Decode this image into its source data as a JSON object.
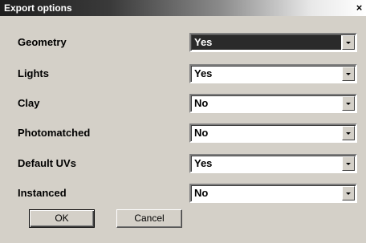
{
  "dialog": {
    "title": "Export options",
    "close_glyph": "×"
  },
  "options": [
    {
      "label": "Geometry",
      "value": "Yes",
      "highlighted": true
    },
    {
      "label": "Lights",
      "value": "Yes",
      "highlighted": false
    },
    {
      "label": "Clay",
      "value": "No",
      "highlighted": false
    },
    {
      "label": "Photomatched",
      "value": "No",
      "highlighted": false
    },
    {
      "label": "Default UVs",
      "value": "Yes",
      "highlighted": false
    },
    {
      "label": "Instanced",
      "value": "No",
      "highlighted": false
    }
  ],
  "buttons": {
    "ok_label": "OK",
    "cancel_label": "Cancel"
  },
  "icons": {
    "close": "close-icon",
    "dropdown": "chevron-down-icon"
  }
}
